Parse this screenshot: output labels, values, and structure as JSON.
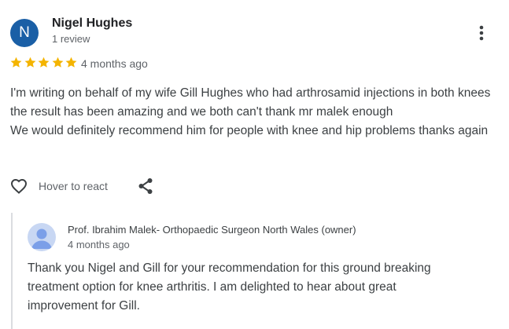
{
  "reviewer": {
    "initial": "N",
    "name": "Nigel Hughes",
    "review_count": "1 review",
    "avatar_color": "#1a5fa6"
  },
  "review": {
    "rating": 5,
    "star_color": "#f4b400",
    "time_ago": "4 months ago",
    "text": "I'm writing on behalf of my wife Gill Hughes who had arthrosamid injections in both knees the result has been amazing and we both can't thank mr malek enough\nWe would definitely recommend him for people with knee and hip problems thanks again"
  },
  "actions": {
    "react_label": "Hover to react",
    "react_icon": "heart-outline-icon",
    "share_icon": "share-icon",
    "more_icon": "more-vertical-icon"
  },
  "owner_reply": {
    "name": "Prof. Ibrahim Malek- Orthopaedic Surgeon North Wales (owner)",
    "time_ago": "4 months ago",
    "text": "Thank you Nigel and Gill for your recommendation for this ground breaking treatment option for knee arthritis. I am delighted to hear about great improvement for Gill.",
    "avatar_icon": "person-avatar-icon"
  }
}
